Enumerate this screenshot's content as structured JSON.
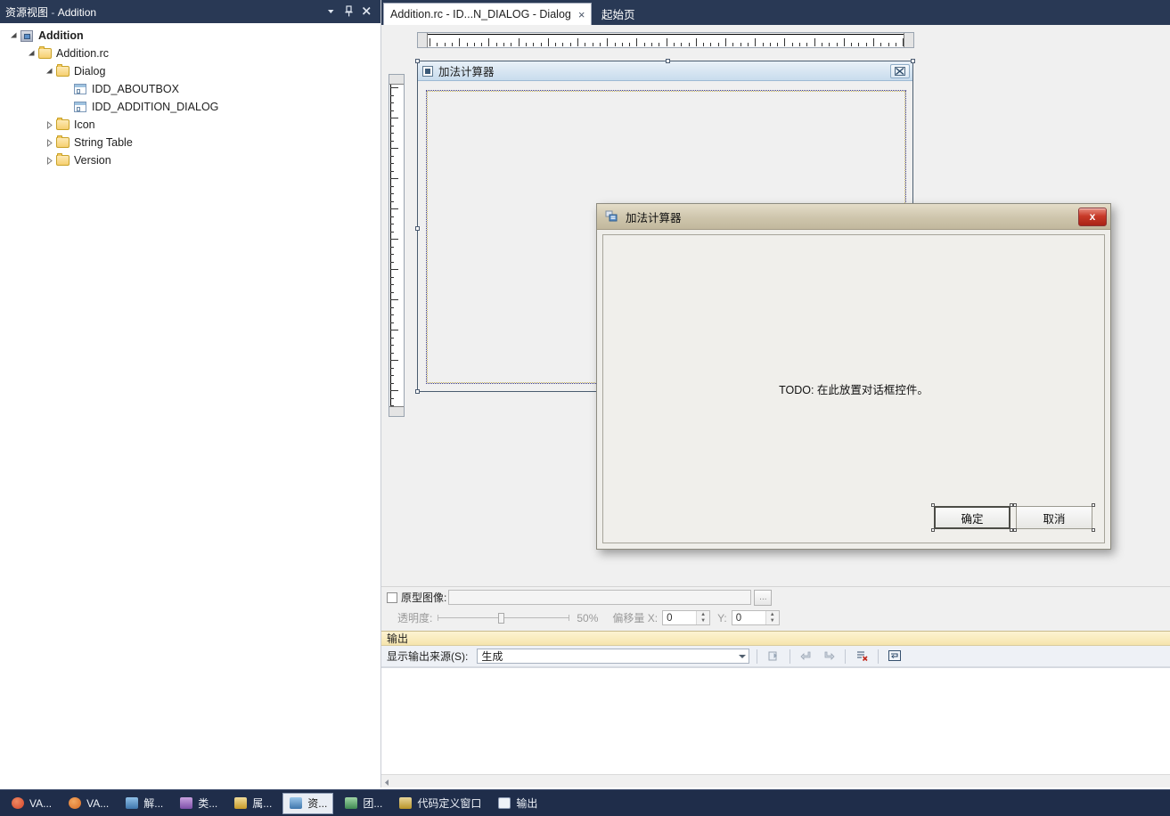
{
  "resource_panel": {
    "title_main": "资源视图",
    "title_sep": " - ",
    "title_sub": "Addition",
    "icons": {
      "dropdown": "chevron-down-icon",
      "pin": "pin-icon",
      "close": "close-icon"
    },
    "tree": [
      {
        "label": "Addition",
        "depth": 0,
        "icon": "project-icon",
        "expander": "expanded",
        "bold": true
      },
      {
        "label": "Addition.rc",
        "depth": 1,
        "icon": "folder-icon",
        "expander": "expanded",
        "bold": false
      },
      {
        "label": "Dialog",
        "depth": 2,
        "icon": "folder-icon",
        "expander": "expanded",
        "bold": false
      },
      {
        "label": "IDD_ABOUTBOX",
        "depth": 3,
        "icon": "dialog-icon",
        "expander": "none",
        "bold": false
      },
      {
        "label": "IDD_ADDITION_DIALOG",
        "depth": 3,
        "icon": "dialog-icon",
        "expander": "none",
        "bold": false
      },
      {
        "label": "Icon",
        "depth": 2,
        "icon": "folder-icon",
        "expander": "collapsed",
        "bold": false
      },
      {
        "label": "String Table",
        "depth": 2,
        "icon": "folder-icon",
        "expander": "collapsed",
        "bold": false
      },
      {
        "label": "Version",
        "depth": 2,
        "icon": "folder-icon",
        "expander": "collapsed",
        "bold": false
      }
    ]
  },
  "tabs": [
    {
      "label": "Addition.rc - ID...N_DIALOG - Dialog",
      "active": true,
      "closable": true,
      "close_glyph": "×"
    },
    {
      "label": "起始页",
      "active": false,
      "closable": false,
      "close_glyph": ""
    }
  ],
  "design_dialog": {
    "title": "加法计算器",
    "icon": "dialog-resource-icon",
    "close_icon": "close-box-icon"
  },
  "run_dialog": {
    "title": "加法计算器",
    "icon": "app-icon",
    "close_label": "x",
    "todo_text": "TODO: 在此放置对话框控件。",
    "buttons": [
      {
        "label": "确定",
        "default": true
      },
      {
        "label": "取消",
        "default": false
      }
    ]
  },
  "prototype_bar": {
    "checkbox_label": "原型图像:",
    "path_value": "",
    "browse_label": "...",
    "transparency_label": "透明度:",
    "transparency_value": "50%",
    "offset_label": "偏移量 X:",
    "offset_x": "0",
    "offset_y_label": "Y:",
    "offset_y": "0"
  },
  "output_panel": {
    "title": "输出",
    "source_label": "显示输出来源(S):",
    "source_value": "生成",
    "toolbar_icons": [
      "jump-to-location-icon",
      "navigate-previous-icon",
      "navigate-next-icon",
      "clear-all-icon",
      "toggle-word-wrap-icon"
    ],
    "content": ""
  },
  "taskbar": {
    "items": [
      {
        "label": "VA...",
        "icon": "va-tomato-icon",
        "selected": false,
        "color": "#e05a32"
      },
      {
        "label": "VA...",
        "icon": "va-outline-icon",
        "selected": false,
        "color": "#e07b32"
      },
      {
        "label": "解...",
        "icon": "solution-explorer-icon",
        "selected": false,
        "color": "#5b8fc9"
      },
      {
        "label": "类...",
        "icon": "class-view-icon",
        "selected": false,
        "color": "#9b6fc0"
      },
      {
        "label": "属...",
        "icon": "properties-icon",
        "selected": false,
        "color": "#c9a227"
      },
      {
        "label": "资...",
        "icon": "resource-view-icon",
        "selected": true,
        "color": "#5b8fc9"
      },
      {
        "label": "团...",
        "icon": "team-explorer-icon",
        "selected": false,
        "color": "#4f9f5f"
      },
      {
        "label": "代码定义窗口",
        "icon": "code-definition-icon",
        "selected": false,
        "color": "#c9a227"
      },
      {
        "label": "输出",
        "icon": "output-window-icon",
        "selected": false,
        "color": "#7b8fa8"
      }
    ]
  },
  "theme": {
    "chrome_blue": "#293955",
    "accent_red": "#c83a28",
    "dialog_tan": "#cec5ac",
    "output_yellow": "#f6e5ad"
  }
}
